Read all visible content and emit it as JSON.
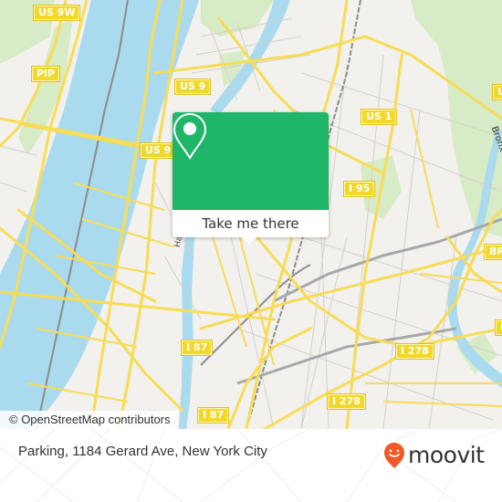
{
  "map": {
    "colors": {
      "land": "#f2f1ee",
      "water": "#aadaee",
      "park": "#d7ebc6",
      "road_major": "#f7dc55",
      "road_minor": "#cfcbc4",
      "rail": "#8a8a8a",
      "accent": "#1fb66a",
      "logo_orange": "#f05a28"
    },
    "road_labels": [
      {
        "id": "us9w",
        "text": "US 9W"
      },
      {
        "id": "pip",
        "text": "PIP"
      },
      {
        "id": "us9-top",
        "text": "US 9"
      },
      {
        "id": "us9-mid",
        "text": "US 9"
      },
      {
        "id": "us1",
        "text": "US 1"
      },
      {
        "id": "i95",
        "text": "I 95"
      },
      {
        "id": "i87-mid",
        "text": "I 87"
      },
      {
        "id": "i87-bottom",
        "text": "I 87"
      },
      {
        "id": "i278-right",
        "text": "I 278"
      },
      {
        "id": "i278-bottom",
        "text": "I 278"
      },
      {
        "id": "br-top",
        "text": "BR"
      },
      {
        "id": "b-right",
        "text": "B"
      },
      {
        "id": "left-edge",
        "text": "U"
      }
    ],
    "feature_labels": {
      "bronx_river": "Bronx River",
      "harlem_river": "Harlem"
    },
    "attribution": "© OpenStreetMap contributors"
  },
  "popup": {
    "icon": "map-pin-icon",
    "button_label": "Take me there"
  },
  "footer": {
    "place_title": "Parking, 1184 Gerard Ave, New York City",
    "logo_text": "moovit",
    "logo_icon": "moovit-smile-pin-icon"
  }
}
